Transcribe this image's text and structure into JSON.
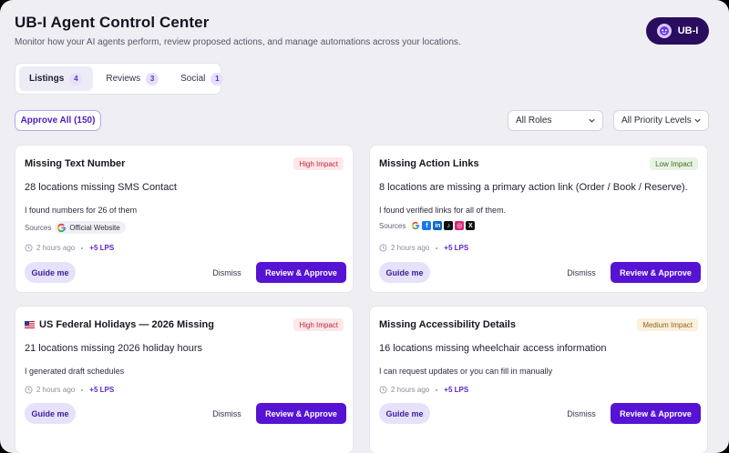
{
  "header": {
    "title": "UB-I Agent Control Center",
    "subtitle": "Monitor how your AI agents perform, review proposed actions, and manage automations across your locations.",
    "brand_label": "UB-I",
    "brand_icon": "agent-face-icon"
  },
  "tabs": [
    {
      "label": "Listings",
      "count": "4",
      "active": true
    },
    {
      "label": "Reviews",
      "count": "3",
      "active": false
    },
    {
      "label": "Social",
      "count": "1",
      "active": false
    }
  ],
  "toolbar": {
    "approve_all_label": "Approve All (150)",
    "roles_select": "All Roles",
    "priority_select": "All Priority Levels"
  },
  "cards": [
    {
      "title": "Missing Text Number",
      "impact": "High Impact",
      "headline": "28 locations missing SMS Contact",
      "detail": "I found numbers for 26 of them",
      "sources_label": "Sources",
      "source_chip": "Official Website",
      "time": "2 hours ago",
      "lps": "+5 LPS",
      "guide_label": "Guide me",
      "dismiss_label": "Dismiss",
      "review_label": "Review & Approve"
    },
    {
      "title": "Missing Action Links",
      "impact": "Low Impact",
      "headline": "8 locations are missing a primary action link (Order / Book / Reserve).",
      "detail": "I found verified links for all of them.",
      "sources_label": "Sources",
      "time": "2 hours ago",
      "lps": "+5 LPS",
      "guide_label": "Guide me",
      "dismiss_label": "Dismiss",
      "review_label": "Review & Approve"
    },
    {
      "title": "US Federal Holidays — 2026 Missing",
      "flag_icon": "us-flag-icon",
      "impact": "High Impact",
      "headline": "21 locations missing 2026 holiday hours",
      "detail": "I generated draft schedules",
      "time": "2 hours ago",
      "lps": "+5 LPS",
      "guide_label": "Guide me",
      "dismiss_label": "Dismiss",
      "review_label": "Review & Approve"
    },
    {
      "title": "Missing Accessibility Details",
      "impact": "Medium Impact",
      "headline": "16 locations missing wheelchair access information",
      "detail": "I can request updates or you can fill in manually",
      "time": "2 hours ago",
      "lps": "+5 LPS",
      "guide_label": "Guide me",
      "dismiss_label": "Dismiss",
      "review_label": "Review & Approve"
    }
  ],
  "colors": {
    "accent": "#5613d4",
    "brand_bg": "#2a0d5e",
    "page_bg": "#eeeef3"
  }
}
